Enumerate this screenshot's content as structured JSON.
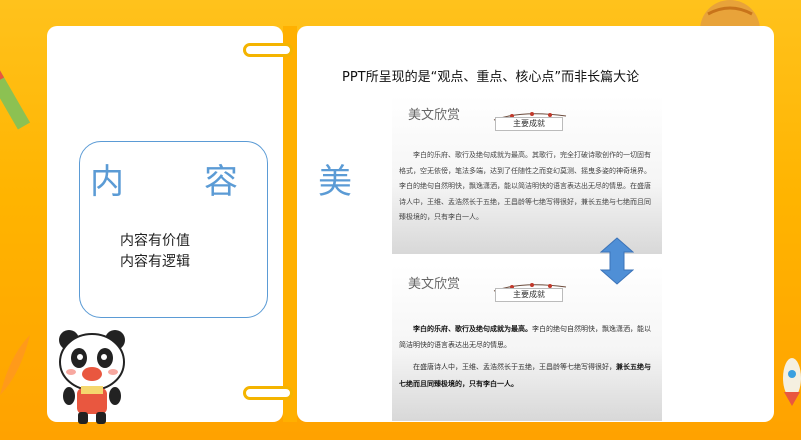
{
  "left_panel": {
    "title": "内　容　美",
    "points": [
      "内容有价值",
      "内容有逻辑"
    ]
  },
  "right_panel": {
    "heading": "PPT所呈现的是“观点、重点、核心点”而非长篇大论",
    "slides": [
      {
        "title": "美文欣赏",
        "badge": "主要成就",
        "paragraph": "李白的乐府、歌行及绝句成就为最高。其歌行，完全打破诗歌创作的一切固有格式，空无依傍，笔法多端，达到了任随性之而变幻莫测、摇曳多姿的神奇境界。李白的绝句自然明快，飘逸潇洒，能以简洁明快的语言表达出无尽的情思。在盛唐诗人中，王维、孟浩然长于五绝，王昌龄等七绝写得很好，兼长五绝与七绝而且同臻极境的，只有李白一人。"
      },
      {
        "title": "美文欣赏",
        "badge": "主要成就",
        "p1_bold": "李白的乐府、歌行及绝句成就为最高。",
        "p1_rest": "李白的绝句自然明快，飘逸潇洒，能以简洁明快的语言表达出无尽的情思。",
        "p2_rest": "在盛唐诗人中，王维、孟浩然长于五绝，王昌龄等七绝写得很好，",
        "p2_bold": "兼长五绝与七绝而且同臻极境的，只有李白一人。"
      }
    ]
  },
  "colors": {
    "background": "#ffb400",
    "accent_blue": "#5b9bd5",
    "ring_yellow": "#f4b400",
    "arrow_blue": "#4f8fd6"
  },
  "icons": {
    "swap_arrow": "double-vertical-arrow-icon",
    "mascot": "panda-mascot-icon"
  }
}
